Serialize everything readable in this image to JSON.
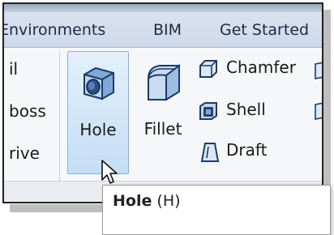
{
  "ribbon": {
    "tabs": [
      {
        "label": "Environments"
      },
      {
        "label": "BIM"
      },
      {
        "label": "Get Started"
      }
    ],
    "left_column": {
      "items": [
        {
          "label": "il"
        },
        {
          "label": "boss"
        },
        {
          "label": "rive"
        }
      ]
    },
    "large_buttons": {
      "hole": {
        "label": "Hole",
        "icon": "hole-icon"
      },
      "fillet": {
        "label": "Fillet",
        "icon": "fillet-icon"
      }
    },
    "small_buttons": [
      {
        "label": "Chamfer",
        "icon": "chamfer-icon"
      },
      {
        "label": "Shell",
        "icon": "shell-icon"
      },
      {
        "label": "Draft",
        "icon": "draft-icon"
      }
    ]
  },
  "tooltip": {
    "title": "Hole",
    "shortcut": "(H)"
  },
  "colors": {
    "highlight_fill": "#c4def4",
    "highlight_border": "#7fb2dc",
    "tab_background": "#d4deec"
  }
}
